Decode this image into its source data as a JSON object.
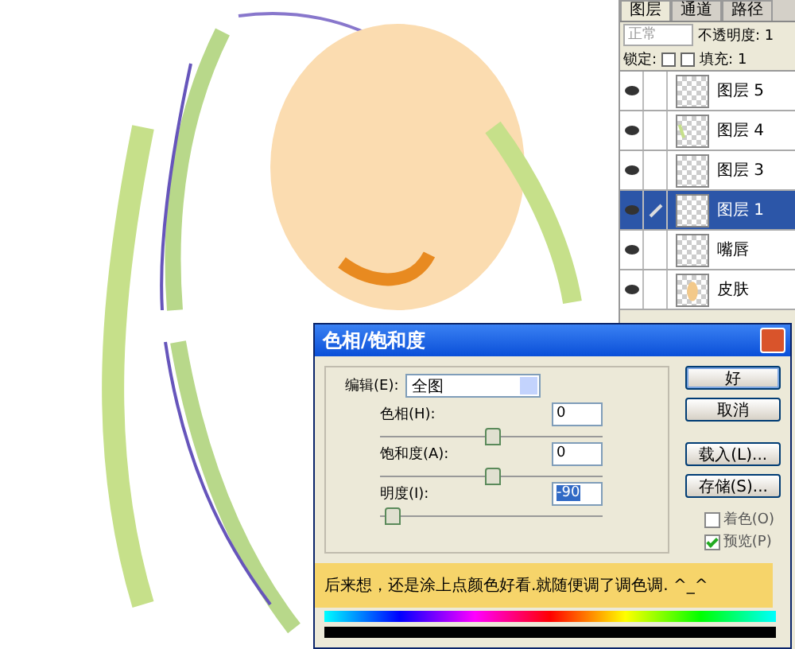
{
  "layers_panel": {
    "tabs": [
      {
        "label": "图层",
        "selected": true
      },
      {
        "label": "通道",
        "selected": false
      },
      {
        "label": "路径",
        "selected": false
      }
    ],
    "blend_mode": "正常",
    "opacity_label": "不透明度: 1",
    "lock_label": "锁定:",
    "fill_label": "填充: 1",
    "layers": [
      {
        "name": "图层 5",
        "visible": true,
        "selected": false,
        "brush": false,
        "kind": "empty"
      },
      {
        "name": "图层 4",
        "visible": true,
        "selected": false,
        "brush": false,
        "kind": "green"
      },
      {
        "name": "图层 3",
        "visible": true,
        "selected": false,
        "brush": false,
        "kind": "empty"
      },
      {
        "name": "图层 1",
        "visible": true,
        "selected": true,
        "brush": true,
        "kind": "empty"
      },
      {
        "name": "嘴唇",
        "visible": true,
        "selected": false,
        "brush": false,
        "kind": "empty"
      },
      {
        "name": "皮肤",
        "visible": true,
        "selected": false,
        "brush": false,
        "kind": "skin"
      }
    ]
  },
  "dialog": {
    "title": "色相/饱和度",
    "edit_label": "编辑(E):",
    "edit_value": "全图",
    "sliders": [
      {
        "label": "色相(H):",
        "value": "0",
        "level": 0.5,
        "highlighted": false
      },
      {
        "label": "饱和度(A):",
        "value": "0",
        "level": 0.5,
        "highlighted": false
      },
      {
        "label": "明度(I):",
        "value": "-90",
        "level": 0.05,
        "highlighted": true
      }
    ],
    "buttons": [
      {
        "label": "好",
        "default": true
      },
      {
        "label": "取消",
        "default": false
      },
      {
        "label": "载入(L)...",
        "default": false
      },
      {
        "label": "存储(S)...",
        "default": false
      }
    ],
    "checkboxes": [
      {
        "label": "着色(O)",
        "checked": false
      },
      {
        "label": "预览(P)",
        "checked": true
      }
    ]
  },
  "caption": "后来想，还是涂上点颜色好看.就随便调了调色调. ^_^"
}
